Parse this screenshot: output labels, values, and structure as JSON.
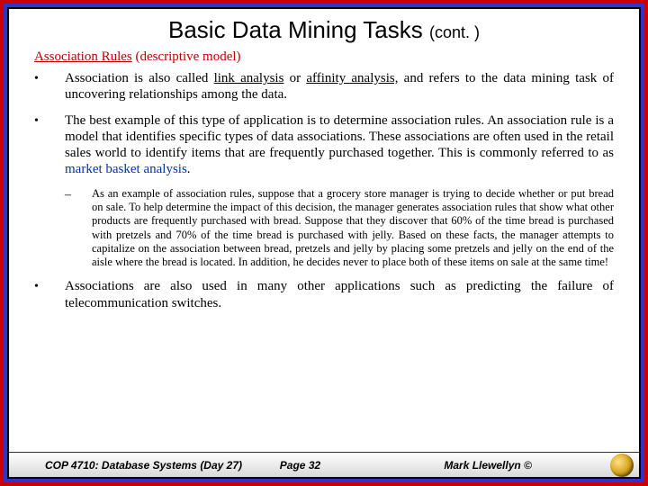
{
  "title": {
    "main": "Basic Data Mining Tasks",
    "cont": "(cont. )"
  },
  "subtitle": {
    "lead": "Association Rules",
    "tail": " (descriptive model)"
  },
  "bullets": {
    "b1": {
      "pre": "Association is also called ",
      "u1": "link analysis",
      "mid": " or ",
      "u2": "affinity analysis,",
      "post": " and refers to the data mining task of uncovering relationships among the data."
    },
    "b2": {
      "pre": "The best example of this type of application is to determine association rules.  An association rule is a model that identifies specific types of data associations.  These associations are often used in the retail sales world to identify items that are frequently purchased together.   This is commonly referred to as ",
      "blue": "market basket analysis",
      "post": "."
    },
    "sub1": "As an example of association rules, suppose that a grocery store manager is trying to decide whether or put bread on sale.  To help determine the impact of this decision, the manager generates association rules that show what other products are frequently purchased with bread.  Suppose that they discover that 60% of the time bread is purchased with pretzels and 70% of the time bread is purchased with jelly.  Based on these facts, the manager attempts to capitalize on the association between bread, pretzels and jelly by placing some pretzels and jelly on the end of the aisle where the bread is located.  In addition, he decides never to place both of these items on sale at the same time!",
    "b3": "Associations are also used in many other applications such as predicting the failure of telecommunication switches."
  },
  "footer": {
    "left": "COP 4710: Database Systems  (Day 27)",
    "mid": "Page 32",
    "right": "Mark Llewellyn ©"
  }
}
